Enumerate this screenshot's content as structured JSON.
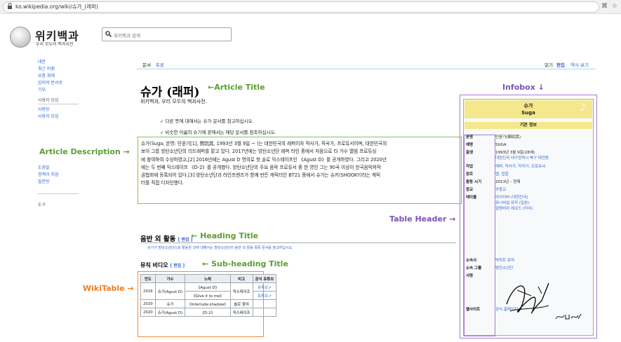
{
  "browser": {
    "url": "ko.wikipedia.org/wiki/슈가_(래퍼)",
    "bookmark_glyph": "⌘",
    "star_glyph": "☆"
  },
  "site": {
    "name": "위키백과",
    "tagline": "우리 모두의 백과사전",
    "search_placeholder": "위키백과 검색"
  },
  "sidebar": {
    "main_items": [
      "대문",
      "최근 바뀜",
      "요즘 화제",
      "임의의 문서로",
      "기부"
    ],
    "section_user": "사용자 모임",
    "user_items": [
      "사랑방",
      "사용자 모임"
    ],
    "section_help_items": [
      "도움말",
      "정책과 지침",
      "질문방"
    ],
    "section_tools": "도구"
  },
  "tabs": {
    "article": "문서",
    "talk": "토론",
    "read": "읽기",
    "edit": "편집",
    "history": "역사 보기"
  },
  "article": {
    "title": "슈가 (래퍼)",
    "from": "위키백과, 우리 모두의 백과사전.",
    "hatnote1": "다른 뜻에 대해서는 슈가 문서를 참고하십시오.",
    "hatnote2": "비슷한 이름의 슈기에 관해서는 해당 문서를 참조하십시오.",
    "description_lines": [
      "슈가(Suga, 본명: 민윤기[1], 閔玧其, 1993년 3월 9일 ~ )는 대한민국의 래퍼이자 작사가, 작곡가, 프로듀서이며, 대한민국의",
      "보이 그룹 방탄소년단의 리드래퍼를 맡고 있다. 2017년에는 방탄소년단 래퍼 라인 중에서 처음으로 타 가수 앨범 프로듀싱",
      "에 참여하여 수상하였고,[2] 2016년에는 Agust D 명의로 첫 솔로 믹스테이프인 《Agust D》를 공개하였다. 그리고 2020년",
      "에는 두 번째 믹스테이프 《D-2》를 공개했다. 방탄소년단의 주요 음악 프로듀서 중 한 명인 그는 90곡 이상이 한국음악저작",
      "권협회에 등록되어 있다.[3] 방탄소년단과 라인프렌즈가 함께 만든 캐릭터인 BT21 중에서 슈가는 슈키(SHOOKY)라는 캐릭",
      "터를 직접 디자인했다."
    ],
    "heading": "음반 외 활동",
    "heading_edit": "[ 편집 ]",
    "heading_note": "슈가가 방탄소년단으로 활동한 것에 대해서는 방탄소년단의 음반 외 활동 목록 문서를 참고하십시오.",
    "subheading": "뮤직 비디오",
    "subheading_edit": "[ 편집 ]"
  },
  "wikitable": {
    "headers": [
      "연도",
      "가수",
      "노래",
      "비고",
      "공식 유튜브"
    ],
    "rows": [
      [
        "2016",
        "슈가(Agust D)",
        "《Agust D》",
        "믹스테이프",
        "유튜브↗"
      ],
      [
        "",
        "",
        "《Give it to me》",
        "",
        "유튜브↗"
      ],
      [
        "2020",
        "슈가",
        "《Interlude:shadow》",
        "솔로 참여",
        ""
      ],
      [
        "2020",
        "슈가(Agust D)",
        "《D-2》",
        "믹스테이프",
        ""
      ]
    ]
  },
  "infobox": {
    "title_ko": "슈가",
    "title_en": "Suga",
    "section": "기본 정보",
    "rows": [
      {
        "label": "본명",
        "value": "민윤기(閔玧其)"
      },
      {
        "label": "예명",
        "value": "SUGA"
      },
      {
        "label": "출생",
        "value": "1993년 3월 9일(28세)"
      },
      {
        "label": "",
        "value": "대한민국 대구광역시 북구 태전동"
      },
      {
        "label": "직업",
        "value": "래퍼, 작사가, 작곡가, 프로듀서"
      },
      {
        "label": "장르",
        "value": "랩, 힙합"
      },
      {
        "label": "활동 시기",
        "value": "2013년 – 현재"
      },
      {
        "label": "종교",
        "value": "무종교"
      },
      {
        "label": "레이블",
        "value": "아이리버 (대한민국)"
      },
      {
        "label": "",
        "value": "유니버설 뮤직 (일본)"
      },
      {
        "label": "",
        "value": "컬럼비아 레코드 (미국)"
      },
      {
        "label": "소속사",
        "value": "빅히트 뮤직"
      },
      {
        "label": "소속 그룹",
        "value": "방탄소년단"
      },
      {
        "label": "서명",
        "value": ""
      },
      {
        "label": "웹사이트",
        "value": "공식 홈페이지 ↗"
      }
    ]
  },
  "annotations": {
    "article_title": "Article Title",
    "infobox": "Infobox",
    "article_description": "Article Description",
    "table_header": "Table Header",
    "heading_title": "Heading Title",
    "sub_heading_title": "Sub-heading Title",
    "wikitable": "WikiTable",
    "arrow_left": "←",
    "arrow_right": "→",
    "arrow_down": "↓"
  },
  "colors": {
    "green": "#5a9e32",
    "purple": "#7e52b5",
    "orange": "#f07d1e",
    "infobox_header": "#f5e88c",
    "link": "#3366cc"
  }
}
